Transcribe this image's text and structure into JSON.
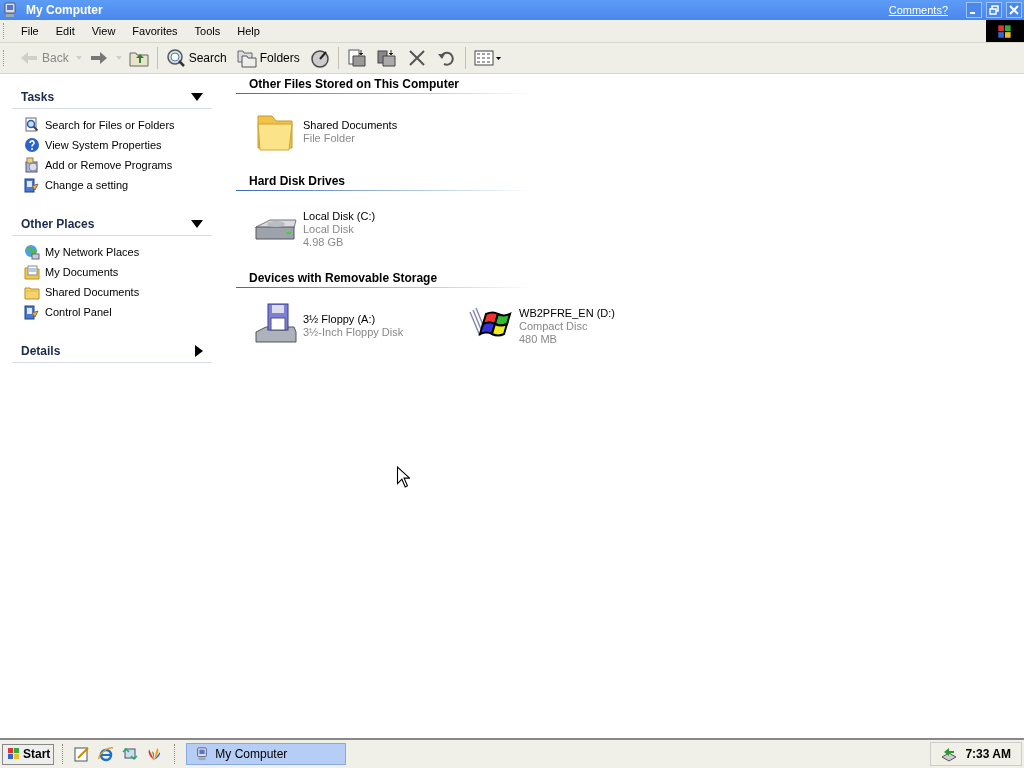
{
  "window": {
    "title": "My Computer",
    "comments_link": "Comments?"
  },
  "menu": [
    "File",
    "Edit",
    "View",
    "Favorites",
    "Tools",
    "Help"
  ],
  "toolbar": [
    {
      "kind": "back",
      "label": "Back",
      "disabled": true
    },
    {
      "kind": "dropdown",
      "disabled": true
    },
    {
      "kind": "forward",
      "disabled": false
    },
    {
      "kind": "dropdown",
      "disabled": true
    },
    {
      "kind": "up",
      "disabled": false
    },
    {
      "kind": "search",
      "label": "Search",
      "disabled": false
    },
    {
      "kind": "folders",
      "label": "Folders",
      "disabled": false
    },
    {
      "kind": "cleanup",
      "disabled": false
    },
    {
      "kind": "moveto",
      "disabled": false
    },
    {
      "kind": "copyto",
      "disabled": false
    },
    {
      "kind": "delete",
      "disabled": false
    },
    {
      "kind": "undo",
      "disabled": false
    },
    {
      "kind": "views",
      "disabled": false
    }
  ],
  "sidebar": [
    {
      "title": "Tasks",
      "expanded": true,
      "items": [
        {
          "kind": "search",
          "label": "Search for Files or Folders"
        },
        {
          "kind": "help",
          "label": "View System Properties"
        },
        {
          "kind": "programs",
          "label": "Add or Remove Programs"
        },
        {
          "kind": "setting",
          "label": "Change a setting"
        }
      ]
    },
    {
      "title": "Other Places",
      "expanded": true,
      "items": [
        {
          "kind": "network",
          "label": "My Network Places"
        },
        {
          "kind": "documents",
          "label": "My Documents"
        },
        {
          "kind": "folder",
          "label": "Shared Documents"
        },
        {
          "kind": "setting",
          "label": "Control Panel"
        }
      ]
    },
    {
      "title": "Details",
      "expanded": false
    }
  ],
  "sections": [
    {
      "title": "Other Files Stored on This Computer",
      "items": [
        {
          "kind": "folder",
          "name": "Shared Documents",
          "details": [
            "File Folder"
          ]
        }
      ]
    },
    {
      "title": "Hard Disk Drives",
      "items": [
        {
          "kind": "harddisk",
          "name": "Local Disk (C:)",
          "details": [
            "Local Disk",
            "4.98 GB"
          ]
        }
      ]
    },
    {
      "title": "Devices with Removable Storage",
      "items": [
        {
          "kind": "floppy",
          "name": "3½ Floppy (A:)",
          "details": [
            "3½-Inch Floppy Disk"
          ]
        },
        {
          "kind": "cd",
          "name": "WB2PFRE_EN (D:)",
          "details": [
            "Compact Disc",
            "480 MB"
          ]
        }
      ]
    }
  ],
  "taskbar": {
    "start": "Start",
    "quick_launch": [
      {
        "kind": "notepad"
      },
      {
        "kind": "ie"
      },
      {
        "kind": "sync"
      },
      {
        "kind": "msn"
      }
    ],
    "tasks": [
      {
        "label": "My Computer",
        "selected": true
      }
    ],
    "clock": "7:33 AM"
  }
}
